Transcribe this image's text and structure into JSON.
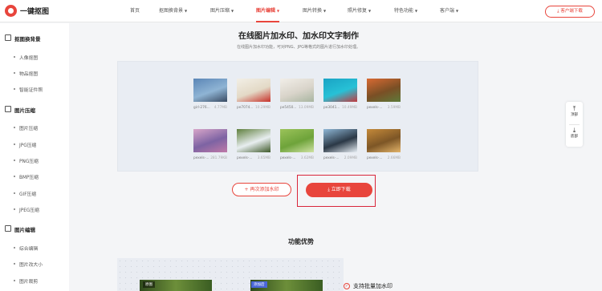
{
  "header": {
    "logo_text": "一键抠图",
    "nav": [
      {
        "label": "首页",
        "has_menu": false
      },
      {
        "label": "抠图换背景",
        "has_menu": true
      },
      {
        "label": "图片压缩",
        "has_menu": true
      },
      {
        "label": "图片编辑",
        "has_menu": true,
        "active": true
      },
      {
        "label": "图片转换",
        "has_menu": true
      },
      {
        "label": "照片修复",
        "has_menu": true
      },
      {
        "label": "特色功能",
        "has_menu": true
      },
      {
        "label": "客户端",
        "has_menu": true
      }
    ],
    "download_button": "客户端下载"
  },
  "sidebar": {
    "sections": [
      {
        "title": "抠图换背景",
        "items": [
          "人像抠图",
          "物品抠图",
          "智能证件照"
        ]
      },
      {
        "title": "图片压缩",
        "items": [
          "图片压缩",
          "JPG压缩",
          "PNG压缩",
          "BMP压缩",
          "GIF压缩",
          "JPEG压缩"
        ]
      },
      {
        "title": "图片编辑",
        "items": [
          "综合编辑",
          "图片改大小",
          "图片裁剪"
        ]
      }
    ]
  },
  "main": {
    "title": "在线图片加水印、加水印文字制作",
    "subtitle": "在线图片加水印功能，可对PNG、JPG等格式的图片进行加水印处理。",
    "thumbnails": [
      {
        "name": "girl-276...",
        "size": "4.77MB",
        "colors": [
          "#5b86b6",
          "#8fb4d4",
          "#394a62"
        ]
      },
      {
        "name": "pe7074...",
        "size": "10.29MB",
        "colors": [
          "#f2efe6",
          "#e3d9c6",
          "#c7322a"
        ]
      },
      {
        "name": "pe5450...",
        "size": "13.09MB",
        "colors": [
          "#f1eee8",
          "#d9d4ca",
          "#a8b5a0"
        ]
      },
      {
        "name": "pe3041...",
        "size": "10.49MB",
        "colors": [
          "#1aa3c4",
          "#27c1d6",
          "#c23a3f"
        ]
      },
      {
        "name": "pexels-...",
        "size": "3.59MB",
        "colors": [
          "#d96a33",
          "#7a4f25",
          "#5e7a3a"
        ]
      },
      {
        "name": "pexels-...",
        "size": "281.79KB",
        "colors": [
          "#d8a6c9",
          "#7d63a3",
          "#c07aa8"
        ]
      },
      {
        "name": "pexels-...",
        "size": "3.65MB",
        "colors": [
          "#5f7f3d",
          "#e8eef0",
          "#3f5a2a"
        ]
      },
      {
        "name": "pexels-...",
        "size": "3.62MB",
        "colors": [
          "#9bc35a",
          "#6ea33a",
          "#cfe2a3"
        ]
      },
      {
        "name": "pexels-...",
        "size": "2.09MB",
        "colors": [
          "#8fb7d6",
          "#2b3846",
          "#e7eef4"
        ]
      },
      {
        "name": "pexels-...",
        "size": "2.66MB",
        "colors": [
          "#c58a3a",
          "#7d5626",
          "#e3b46a"
        ]
      }
    ],
    "add_again_button": "再次添加水印",
    "download_now_button": "立即下载",
    "advantages_title": "功能优势",
    "preview_tag_original": "原图",
    "preview_tag_watermark": "添加后",
    "feature_text": "支持批量加水印"
  },
  "floating": {
    "top_label": "顶部",
    "bottom_label": "底部"
  },
  "colors": {
    "accent": "#e8453c",
    "highlight_box": "#d9263b"
  }
}
